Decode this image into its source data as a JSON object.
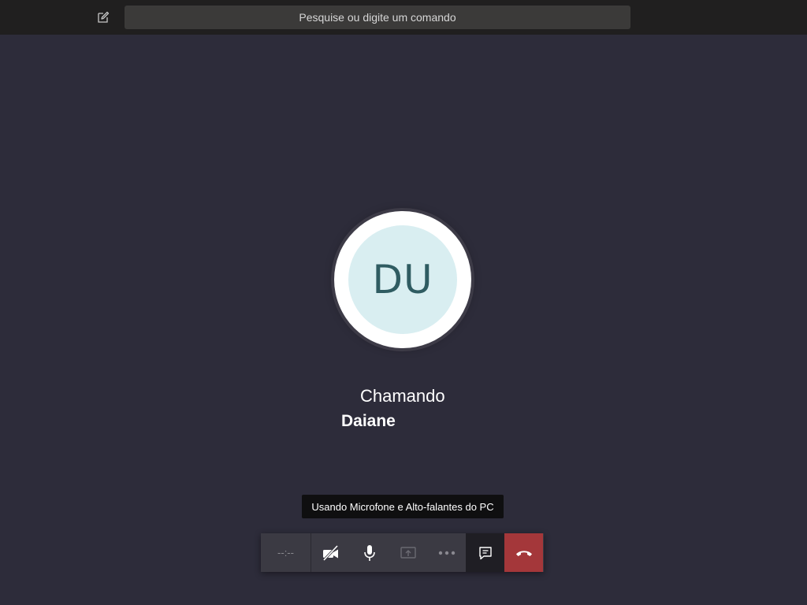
{
  "header": {
    "compose_icon": "compose-icon",
    "search_placeholder": "Pesquise ou digite um comando"
  },
  "call": {
    "avatar_initials": "DU",
    "status": "Chamando",
    "callee_name": "Daiane",
    "tooltip": "Usando Microfone e Alto-falantes do PC"
  },
  "controls": {
    "timer": "--:--",
    "buttons": [
      {
        "name": "video-off",
        "icon": "camera-off-icon",
        "enabled": true
      },
      {
        "name": "microphone",
        "icon": "microphone-icon",
        "enabled": true
      },
      {
        "name": "share-screen",
        "icon": "share-screen-icon",
        "enabled": false
      },
      {
        "name": "more-options",
        "icon": "ellipsis-icon",
        "enabled": false
      },
      {
        "name": "chat",
        "icon": "chat-icon",
        "enabled": true
      },
      {
        "name": "hang-up",
        "icon": "hang-up-icon",
        "enabled": true
      }
    ]
  },
  "colors": {
    "background": "#2d2c3a",
    "topbar": "#201f1f",
    "avatar_fill": "#d9eef1",
    "avatar_text": "#2f5c62",
    "hangup": "#a4373a"
  }
}
